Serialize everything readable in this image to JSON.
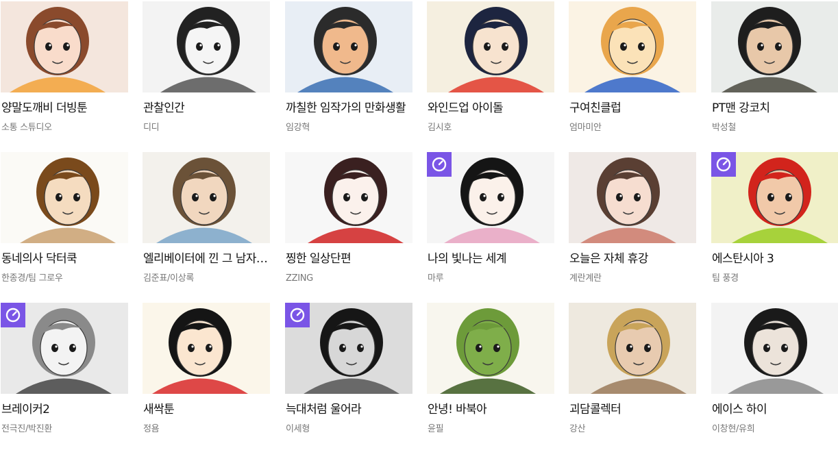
{
  "colors": {
    "badge": "#7a55e6",
    "title": "#111111",
    "author": "#777777"
  },
  "webtoons": [
    {
      "title": "양말도깨비 더빙툰",
      "author": "소통 스튜디오",
      "badge": false,
      "thumb_bg": "#f4e6dd",
      "hair": "#8a4a2c",
      "skin": "#f9dccb",
      "accent": "#f2a23a"
    },
    {
      "title": "관찰인간",
      "author": "디디",
      "badge": false,
      "thumb_bg": "#f3f3f3",
      "hair": "#222222",
      "skin": "#f5f5f5",
      "accent": "#555555"
    },
    {
      "title": "까칠한 임작가의 만화생활",
      "author": "임강혁",
      "badge": false,
      "thumb_bg": "#e8eef5",
      "hair": "#2b2b2b",
      "skin": "#f0b98c",
      "accent": "#3a6fb3"
    },
    {
      "title": "와인드업 아이돌",
      "author": "김시호",
      "badge": false,
      "thumb_bg": "#f5efe0",
      "hair": "#1d2540",
      "skin": "#f7e3cf",
      "accent": "#e03a2a"
    },
    {
      "title": "구여친클럽",
      "author": "엄마미안",
      "badge": false,
      "thumb_bg": "#fbf3e4",
      "hair": "#e9a64c",
      "skin": "#fbe2b8",
      "accent": "#2f63c8"
    },
    {
      "title": "PT맨 강코치",
      "author": "박성철",
      "badge": false,
      "thumb_bg": "#e9ecea",
      "hair": "#1e1e1e",
      "skin": "#e8c8a9",
      "accent": "#4a4a40"
    },
    {
      "title": "동네의사 닥터쿡",
      "author": "한종경/팀 그로우",
      "badge": false,
      "thumb_bg": "#fbfaf6",
      "hair": "#7a4a1c",
      "skin": "#f5dcc0",
      "accent": "#c9a070"
    },
    {
      "title": "엘리베이터에 낀 그 남자는 어떻게 되었나",
      "author": "김준표/이상록",
      "badge": false,
      "thumb_bg": "#f3f1ec",
      "hair": "#6b5238",
      "skin": "#f1d7bf",
      "accent": "#7aa6c9"
    },
    {
      "title": "찡한 일상단편",
      "author": "ZZING",
      "badge": false,
      "thumb_bg": "#f7f7f7",
      "hair": "#3a2020",
      "skin": "#fbf1ec",
      "accent": "#d02222"
    },
    {
      "title": "나의 빛나는 세계",
      "author": "마루",
      "badge": true,
      "thumb_bg": "#f5f5f5",
      "hair": "#151515",
      "skin": "#fbf1ea",
      "accent": "#e7a3c1"
    },
    {
      "title": "오늘은 자체 휴강",
      "author": "계란계란",
      "badge": false,
      "thumb_bg": "#efe9e6",
      "hair": "#5a3f33",
      "skin": "#f6ddd0",
      "accent": "#cc7a6a"
    },
    {
      "title": "에스탄시아 3",
      "author": "팀 풍경",
      "badge": true,
      "thumb_bg": "#f0f0c8",
      "hair": "#d2241c",
      "skin": "#f1c9a9",
      "accent": "#9acd22"
    },
    {
      "title": "브레이커2",
      "author": "전극진/박진환",
      "badge": true,
      "thumb_bg": "#e9e9e9",
      "hair": "#8a8a8a",
      "skin": "#f3f3f3",
      "accent": "#444444"
    },
    {
      "title": "새싹툰",
      "author": "정욤",
      "badge": false,
      "thumb_bg": "#fbf6ea",
      "hair": "#151515",
      "skin": "#fbe6d0",
      "accent": "#d8292a"
    },
    {
      "title": "늑대처럼 울어라",
      "author": "이세형",
      "badge": true,
      "thumb_bg": "#dcdcdc",
      "hair": "#161616",
      "skin": "#d7d7d7",
      "accent": "#555555"
    },
    {
      "title": "안녕! 바북아",
      "author": "윤필",
      "badge": false,
      "thumb_bg": "#f8f6ee",
      "hair": "#6d9b3a",
      "skin": "#7fae4a",
      "accent": "#3c5a22"
    },
    {
      "title": "괴담콜렉터",
      "author": "강산",
      "badge": false,
      "thumb_bg": "#eee9df",
      "hair": "#c9a45a",
      "skin": "#e8cbb0",
      "accent": "#9a7a5a"
    },
    {
      "title": "에이스 하이",
      "author": "이창현/유희",
      "badge": false,
      "thumb_bg": "#f3f3f3",
      "hair": "#1a1a1a",
      "skin": "#ece3da",
      "accent": "#888888"
    }
  ]
}
